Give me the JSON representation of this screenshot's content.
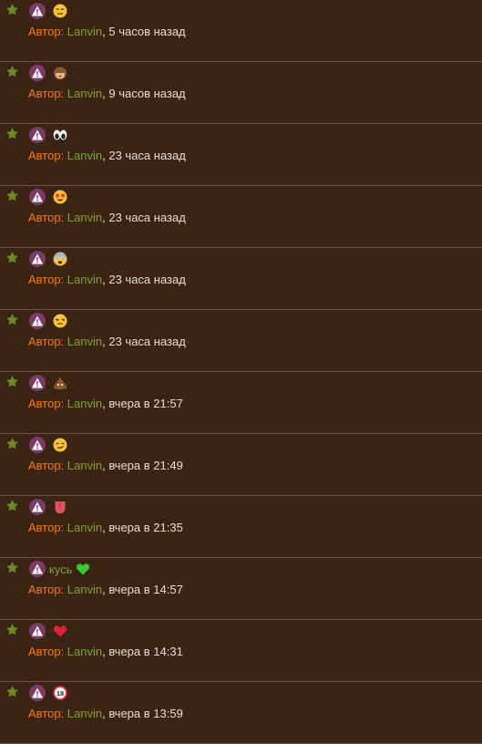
{
  "colors": {
    "background": "#3c2414",
    "divider": "#6b5645",
    "label": "#f07a1e",
    "author": "#7fa12f",
    "text": "#e8ddd0",
    "avatar": "#7e3a66",
    "star": "#6d8a2a"
  },
  "feed": {
    "items": [
      {
        "text": "",
        "emoji": "expressionless-face-icon",
        "label": "Автор:",
        "author": "Lanvin",
        "sep": ",",
        "time": "5 часов назад"
      },
      {
        "text": "",
        "emoji": "see-no-evil-monkey-icon",
        "label": "Автор:",
        "author": "Lanvin",
        "sep": ",",
        "time": "9 часов назад"
      },
      {
        "text": "",
        "emoji": "eyes-icon",
        "label": "Автор:",
        "author": "Lanvin",
        "sep": ",",
        "time": "23 часа назад"
      },
      {
        "text": "",
        "emoji": "star-struck-face-icon",
        "label": "Автор:",
        "author": "Lanvin",
        "sep": ",",
        "time": "23 часа назад"
      },
      {
        "text": "",
        "emoji": "fearful-face-icon",
        "label": "Автор:",
        "author": "Lanvin",
        "sep": ",",
        "time": "23 часа назад"
      },
      {
        "text": "",
        "emoji": "unamused-face-icon",
        "label": "Автор:",
        "author": "Lanvin",
        "sep": ",",
        "time": "23 часа назад"
      },
      {
        "text": "",
        "emoji": "pile-of-poo-icon",
        "label": "Автор:",
        "author": "Lanvin",
        "sep": ",",
        "time": "вчера в 21:57"
      },
      {
        "text": "",
        "emoji": "smirking-face-icon",
        "label": "Автор:",
        "author": "Lanvin",
        "sep": ",",
        "time": "вчера в 21:49"
      },
      {
        "text": "",
        "emoji": "tongue-icon",
        "label": "Автор:",
        "author": "Lanvin",
        "sep": ",",
        "time": "вчера в 21:35"
      },
      {
        "text": "кусь",
        "emoji": "green-heart-icon",
        "label": "Автор:",
        "author": "Lanvin",
        "sep": ",",
        "time": "вчера в 14:57"
      },
      {
        "text": "",
        "emoji": "red-heart-icon",
        "label": "Автор:",
        "author": "Lanvin",
        "sep": ",",
        "time": "вчера в 14:31"
      },
      {
        "text": "",
        "emoji": "no-one-under-eighteen-icon",
        "label": "Автор:",
        "author": "Lanvin",
        "sep": ",",
        "time": "вчера в 13:59"
      }
    ]
  }
}
